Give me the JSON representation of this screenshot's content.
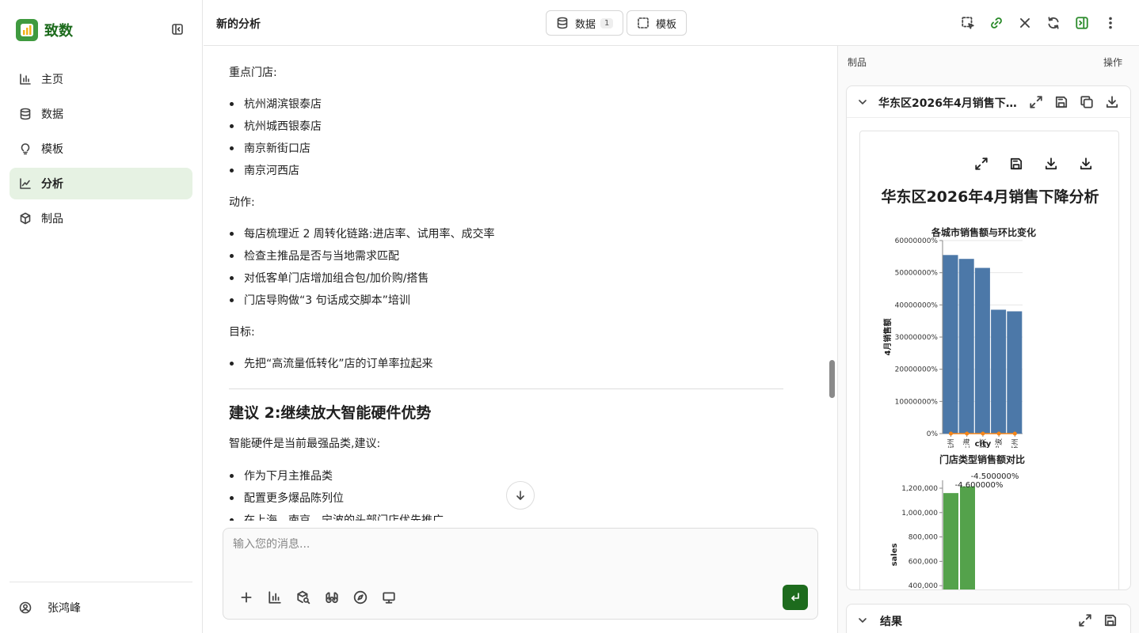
{
  "sidebar": {
    "brand": "致数",
    "items": [
      {
        "label": "主页",
        "icon": "chart-bar-icon"
      },
      {
        "label": "数据",
        "icon": "database-icon"
      },
      {
        "label": "模板",
        "icon": "lightbulb-icon"
      },
      {
        "label": "分析",
        "icon": "line-chart-icon",
        "active": true
      },
      {
        "label": "制品",
        "icon": "box-icon"
      }
    ],
    "user": "张鸿峰"
  },
  "header": {
    "title": "新的分析",
    "data_label": "数据",
    "data_count": "1",
    "template_label": "模板"
  },
  "content": {
    "stores_label": "重点门店:",
    "stores": [
      "杭州湖滨银泰店",
      "杭州城西银泰店",
      "南京新街口店",
      "南京河西店"
    ],
    "actions_label": "动作:",
    "actions": [
      "每店梳理近 2 周转化链路:进店率、试用率、成交率",
      "检查主推品是否与当地需求匹配",
      "对低客单门店增加组合包/加价购/搭售",
      "门店导购做“3 句话成交脚本”培训"
    ],
    "goal_label": "目标:",
    "goals": [
      "先把“高流量低转化”店的订单率拉起来"
    ],
    "heading2": "建议 2:继续放大智能硬件优势",
    "para2": "智能硬件是当前最强品类,建议:",
    "list2": [
      "作为下月主推品类",
      "配置更多爆品陈列位",
      "在上海、南京、宁波的头部门店优先推广"
    ]
  },
  "composer": {
    "placeholder": "输入您的消息..."
  },
  "panel": {
    "header_left": "制品",
    "header_right": "操作",
    "card_title": "华东区2026年4月销售下降分析",
    "viz_title": "华东区2026年4月销售下降分析",
    "result_title": "结果"
  },
  "chart_data": [
    {
      "type": "bar",
      "title": "各城市销售额与环比变化",
      "xlabel": "city",
      "ylabel": "4月销售额",
      "categories": [
        "杭州",
        "上海",
        "南京",
        "宁波",
        "苏州"
      ],
      "values": [
        55500000,
        54300000,
        51500000,
        38500000,
        38000000
      ],
      "line_values": [
        -4500000,
        -4600000,
        -3800000,
        -4200000,
        -3900000
      ],
      "ylim": [
        0,
        60000000
      ],
      "yticks": [
        "0%",
        "10000000%",
        "20000000%",
        "30000000%",
        "40000000%",
        "50000000%",
        "60000000%"
      ],
      "bar_color": "#4c78a8",
      "line_color": "#f58518"
    },
    {
      "type": "bar",
      "title": "门店类型销售额对比",
      "ylabel": "sales",
      "values": [
        1160000,
        1215000
      ],
      "data_labels": [
        "-4.600000%",
        "-4.500000%"
      ],
      "yticks": [
        "400,000",
        "600,000",
        "800,000",
        "1,000,000",
        "1,200,000"
      ],
      "ylim": [
        0,
        1300000
      ],
      "bar_color": "#54a24b"
    }
  ]
}
